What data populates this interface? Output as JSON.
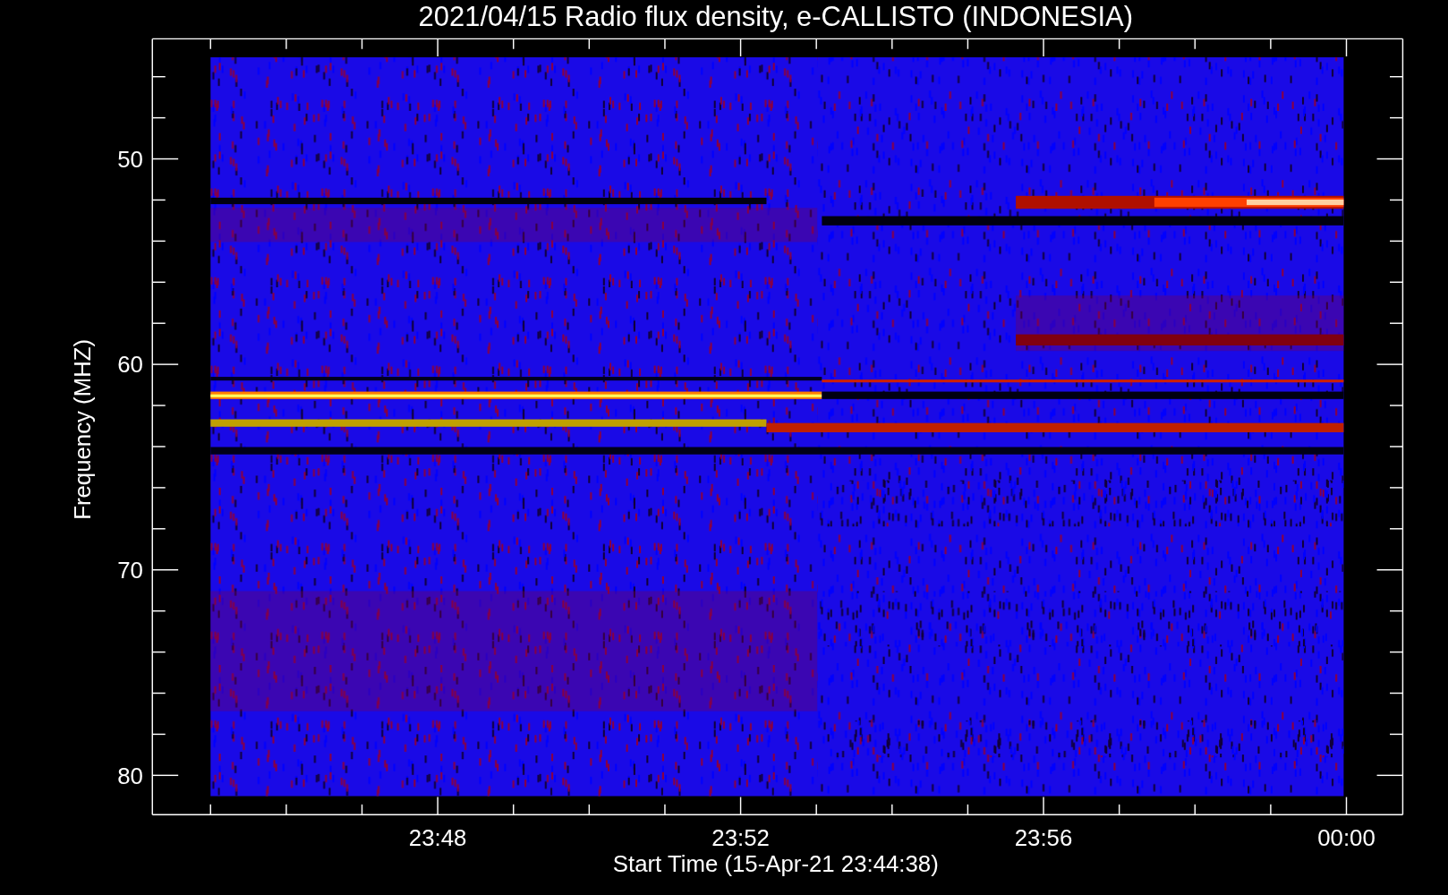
{
  "title": "2021/04/15  Radio flux density, e-CALLISTO (INDONESIA)",
  "y_axis": {
    "label": "Frequency (MHZ)",
    "ticks": [
      "50",
      "60",
      "70",
      "80"
    ]
  },
  "x_axis": {
    "label": "Start Time (15-Apr-21 23:44:38)",
    "ticks": [
      "23:48",
      "23:52",
      "23:56",
      "00:00"
    ]
  }
}
